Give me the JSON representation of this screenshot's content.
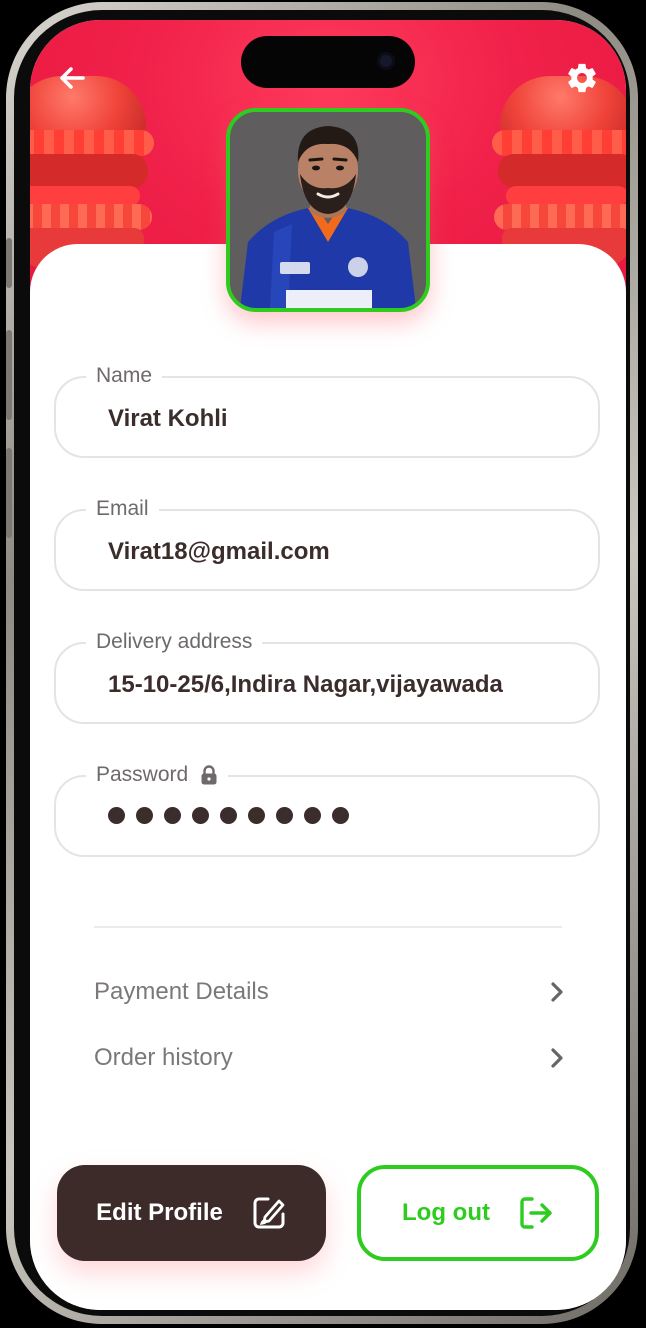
{
  "colors": {
    "accent_green": "#2ecc1f",
    "hero_red": "#f0214a",
    "dark_button": "#3c2b29",
    "text_dark": "#3b2d2c",
    "text_muted": "#7c7878"
  },
  "header": {
    "back_icon": "arrow-left-icon",
    "settings_icon": "gear-icon"
  },
  "profile": {
    "avatar": "profile-photo"
  },
  "fields": {
    "name": {
      "label": "Name",
      "value": "Virat Kohli"
    },
    "email": {
      "label": "Email",
      "value": "Virat18@gmail.com"
    },
    "address": {
      "label": "Delivery address",
      "value": "15-10-25/6,Indira Nagar,vijayawada"
    },
    "password": {
      "label": "Password",
      "masked_length": 9,
      "icon": "lock-icon"
    }
  },
  "menu": {
    "payment": {
      "label": "Payment Details",
      "icon": "chevron-right-icon"
    },
    "orders": {
      "label": "Order history",
      "icon": "chevron-right-icon"
    }
  },
  "actions": {
    "edit_label": "Edit Profile",
    "edit_icon": "edit-icon",
    "logout_label": "Log out",
    "logout_icon": "logout-icon"
  }
}
